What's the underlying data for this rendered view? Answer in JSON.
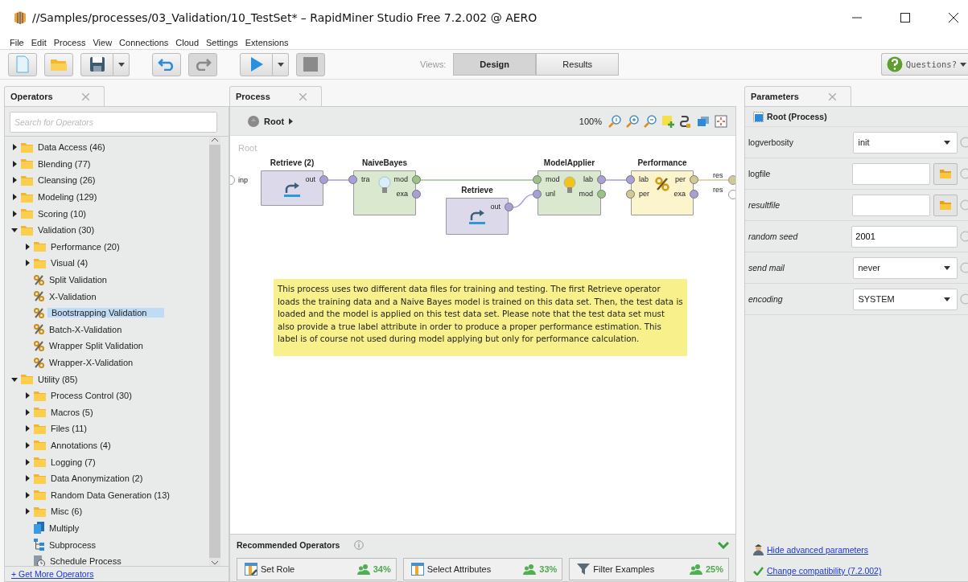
{
  "window": {
    "title": "//Samples/processes/03_Validation/10_TestSet* – RapidMiner Studio Free 7.2.002 @ AERO"
  },
  "menu": [
    "File",
    "Edit",
    "Process",
    "View",
    "Connections",
    "Cloud",
    "Settings",
    "Extensions"
  ],
  "toolbar": {
    "views_label": "Views:",
    "views": [
      {
        "label": "Design",
        "selected": true
      },
      {
        "label": "Results",
        "selected": false
      }
    ],
    "help_button": "Questions?"
  },
  "operators_panel": {
    "tab": "Operators",
    "search": {
      "placeholder": "Search for Operators"
    },
    "tree": [
      {
        "label": "Data Access (46)",
        "kind": "folder",
        "expanded": false,
        "selected": false
      },
      {
        "label": "Blending (77)",
        "kind": "folder",
        "expanded": false,
        "selected": false
      },
      {
        "label": "Cleansing (26)",
        "kind": "folder",
        "expanded": false,
        "selected": false
      },
      {
        "label": "Modeling (129)",
        "kind": "folder",
        "expanded": false,
        "selected": false
      },
      {
        "label": "Scoring (10)",
        "kind": "folder",
        "expanded": false,
        "selected": false
      },
      {
        "label": "Validation (30)",
        "kind": "folder",
        "expanded": true,
        "selected": false,
        "children": [
          {
            "label": "Performance (20)",
            "kind": "folder",
            "expanded": false,
            "selected": false
          },
          {
            "label": "Visual (4)",
            "kind": "folder",
            "expanded": false,
            "selected": false
          },
          {
            "label": "Split Validation",
            "kind": "validation",
            "selected": false
          },
          {
            "label": "X-Validation",
            "kind": "validation",
            "selected": false
          },
          {
            "label": "Bootstrapping Validation",
            "kind": "validation",
            "selected": true
          },
          {
            "label": "Batch-X-Validation",
            "kind": "validation",
            "selected": false
          },
          {
            "label": "Wrapper Split Validation",
            "kind": "validation",
            "selected": false
          },
          {
            "label": "Wrapper-X-Validation",
            "kind": "validation",
            "selected": false
          }
        ]
      },
      {
        "label": "Utility (85)",
        "kind": "folder",
        "expanded": true,
        "selected": false,
        "children": [
          {
            "label": "Process Control (30)",
            "kind": "folder",
            "expanded": false,
            "selected": false
          },
          {
            "label": "Macros (5)",
            "kind": "folder",
            "expanded": false,
            "selected": false
          },
          {
            "label": "Files (11)",
            "kind": "folder",
            "expanded": false,
            "selected": false
          },
          {
            "label": "Annotations (4)",
            "kind": "folder",
            "expanded": false,
            "selected": false
          },
          {
            "label": "Logging (7)",
            "kind": "folder",
            "expanded": false,
            "selected": false
          },
          {
            "label": "Data Anonymization (2)",
            "kind": "folder",
            "expanded": false,
            "selected": false
          },
          {
            "label": "Random Data Generation (13)",
            "kind": "folder",
            "expanded": false,
            "selected": false
          },
          {
            "label": "Misc (6)",
            "kind": "folder",
            "expanded": false,
            "selected": false
          },
          {
            "label": "Multiply",
            "kind": "multiply",
            "selected": false
          },
          {
            "label": "Subprocess",
            "kind": "subprocess",
            "selected": false
          },
          {
            "label": "Schedule Process",
            "kind": "schedule",
            "selected": false
          }
        ]
      }
    ],
    "link": "+ Get More Operators"
  },
  "process_panel": {
    "tab": "Process",
    "breadcrumb": "Root",
    "zoom": "100%",
    "canvas_label": "Root",
    "process_input": "inp",
    "process_outputs": [
      "res",
      "res"
    ],
    "operators": [
      {
        "name": "Retrieve (2)",
        "kind": "retrieve",
        "outputs": [
          {
            "label": "out",
            "kind": "data"
          }
        ]
      },
      {
        "name": "NaiveBayes",
        "kind": "learner",
        "inputs": [
          {
            "label": "tra",
            "kind": "data"
          }
        ],
        "outputs": [
          {
            "label": "mod",
            "kind": "model"
          },
          {
            "label": "exa",
            "kind": "data"
          }
        ]
      },
      {
        "name": "Retrieve",
        "kind": "retrieve",
        "outputs": [
          {
            "label": "out",
            "kind": "data"
          }
        ]
      },
      {
        "name": "ModelApplier",
        "kind": "applier",
        "inputs": [
          {
            "label": "mod",
            "kind": "model"
          },
          {
            "label": "unl",
            "kind": "data"
          }
        ],
        "outputs": [
          {
            "label": "lab",
            "kind": "data"
          },
          {
            "label": "mod",
            "kind": "model"
          }
        ]
      },
      {
        "name": "Performance",
        "kind": "performance",
        "inputs": [
          {
            "label": "lab",
            "kind": "data"
          },
          {
            "label": "per",
            "kind": "perf"
          }
        ],
        "outputs": [
          {
            "label": "per",
            "kind": "perf"
          },
          {
            "label": "exa",
            "kind": "data"
          }
        ]
      }
    ],
    "note": "This process uses two different data files for training and testing. The first Retrieve operator loads the training data and a Naive Bayes model is trained on this data set. Then, the test data is loaded and the model is applied on this test data set. Please note that the test data set must also provide a true label attribute in order to produce a proper performance estimation. This label is of course not used during model applying but only for performance calculation.",
    "recommended": {
      "title": "Recommended Operators",
      "items": [
        {
          "name": "Set Role",
          "kind": "table-edit",
          "percent": "34%"
        },
        {
          "name": "Select Attributes",
          "kind": "table",
          "percent": "33%"
        },
        {
          "name": "Filter Examples",
          "kind": "funnel",
          "percent": "25%"
        }
      ]
    }
  },
  "parameters_panel": {
    "tab": "Parameters",
    "context": "Root (Process)",
    "params": [
      {
        "label": "logverbosity",
        "kind": "select",
        "value": "init",
        "expert": false
      },
      {
        "label": "logfile",
        "kind": "file",
        "expert": false
      },
      {
        "label": "resultfile",
        "kind": "file",
        "expert": true
      },
      {
        "label": "random seed",
        "kind": "text",
        "value": "2001",
        "expert": true
      },
      {
        "label": "send mail",
        "kind": "select",
        "value": "never",
        "expert": true
      },
      {
        "label": "encoding",
        "kind": "select",
        "value": "SYSTEM",
        "expert": true
      }
    ],
    "links": [
      "Hide advanced parameters",
      "Change compatibility (7.2.002)"
    ]
  }
}
